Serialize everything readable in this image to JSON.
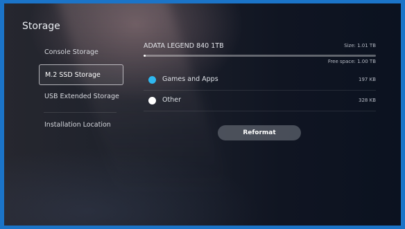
{
  "page": {
    "title": "Storage"
  },
  "sidebar": {
    "items": [
      {
        "label": "Console Storage",
        "selected": false
      },
      {
        "label": "M.2 SSD Storage",
        "selected": true
      },
      {
        "label": "USB Extended Storage",
        "selected": false
      },
      {
        "label": "Installation Location",
        "selected": false
      }
    ]
  },
  "drive": {
    "name": "ADATA LEGEND 840 1TB",
    "size_text": "Size: 1.01 TB",
    "free_space_text": "Free space: 1.00 TB",
    "used_fraction": 0.01
  },
  "usage": [
    {
      "label": "Games and Apps",
      "size": "197 KB",
      "color": "#2fb8f0"
    },
    {
      "label": "Other",
      "size": "328 KB",
      "color": "#ffffff"
    }
  ],
  "actions": {
    "reformat_label": "Reformat"
  }
}
